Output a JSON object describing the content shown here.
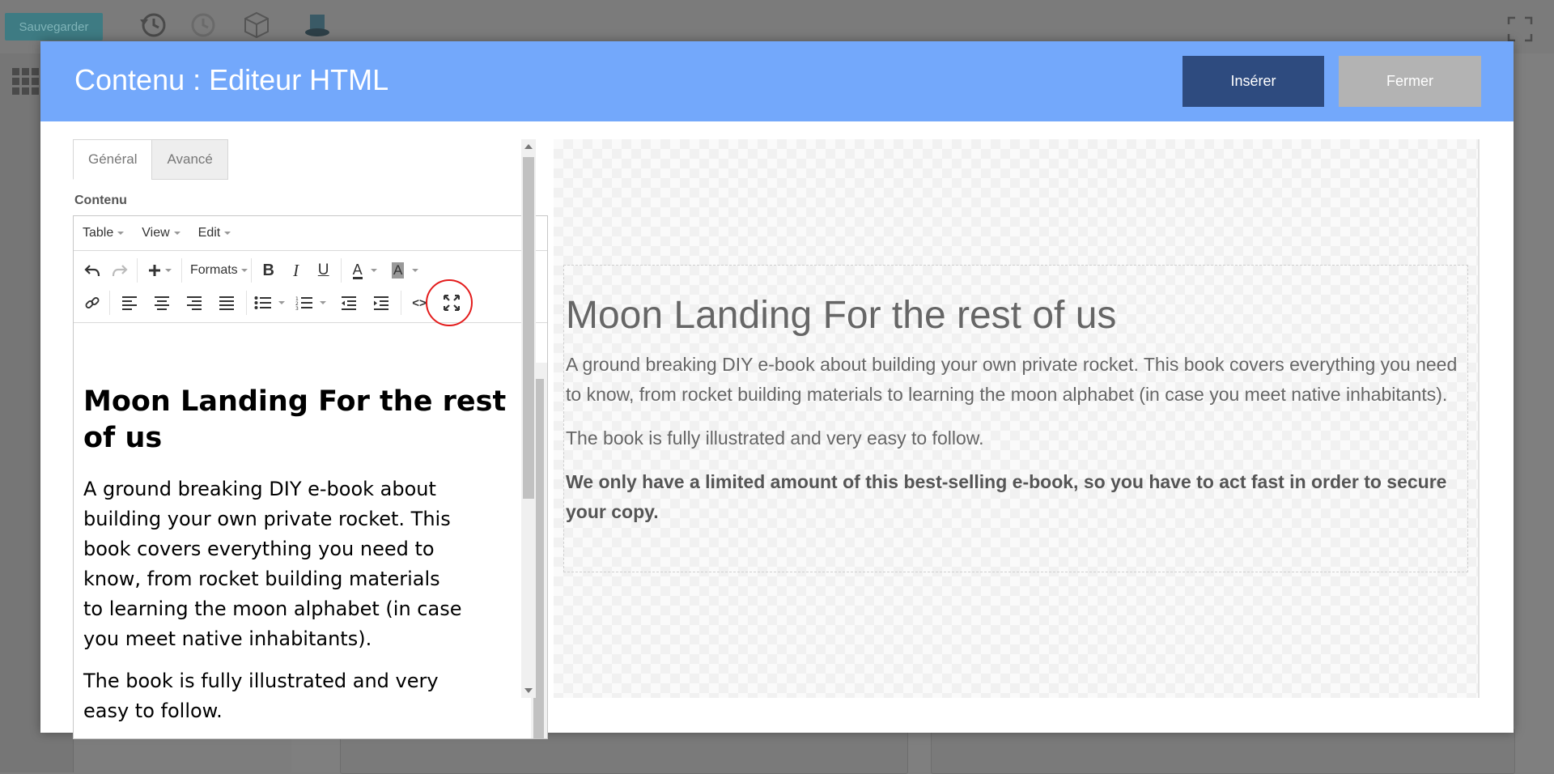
{
  "background": {
    "save_label": "Sauvegarder"
  },
  "modal": {
    "title": "Contenu : Editeur HTML",
    "insert_label": "Insérer",
    "close_label": "Fermer"
  },
  "tabs": [
    {
      "label": "Général",
      "active": true
    },
    {
      "label": "Avancé",
      "active": false
    }
  ],
  "content_label": "Contenu",
  "menubar": [
    "Table",
    "View",
    "Edit"
  ],
  "toolbar": {
    "formats_label": "Formats",
    "bold": "B",
    "italic": "I",
    "underline": "U",
    "text_color": "A",
    "bg_color": "A",
    "source_code": "<>"
  },
  "editor_content": {
    "heading": "Moon Landing For the rest of us",
    "p1": "A ground breaking DIY e-book about building your own private rocket. This book covers everything you need to know, from rocket building materials to learning the moon alphabet (in case you meet native inhabitants).",
    "p2": "The book is fully illustrated and very easy to follow."
  },
  "preview_content": {
    "heading": "Moon Landing For the rest of us",
    "p1": "A ground breaking DIY e-book about building your own private rocket. This book covers everything you need to know, from rocket building materials to learning the moon alphabet (in case you meet native inhabitants).",
    "p2": "The book is fully illustrated and very easy to follow.",
    "p3": "We only have a limited amount of this best-selling e-book, so you have to act fast in order to secure your copy."
  },
  "colors": {
    "header_bg": "#73a8fb",
    "insert_bg": "#2e4b7f",
    "close_bg": "#b3b3b3",
    "highlight_circle": "#e31b1b"
  }
}
